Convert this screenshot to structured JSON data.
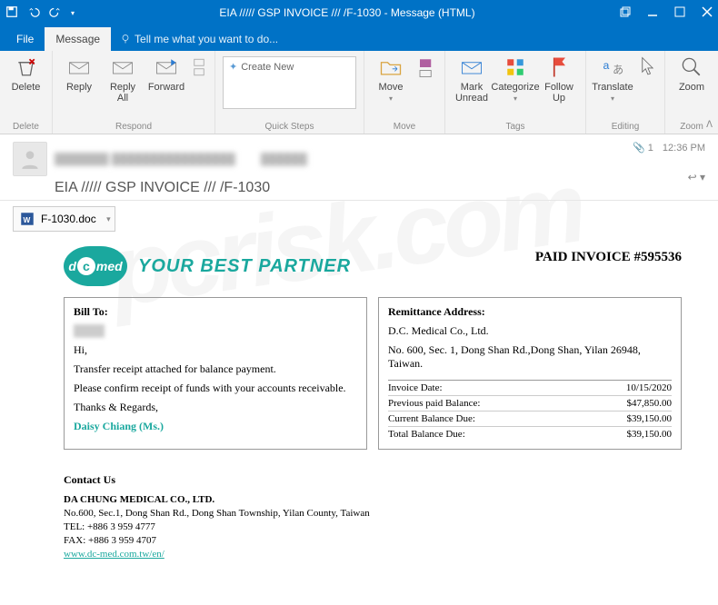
{
  "window": {
    "title": "EIA ///// GSP INVOICE /// /F-1030 - Message (HTML)"
  },
  "menu": {
    "file": "File",
    "message": "Message",
    "tell_me": "Tell me what you want to do..."
  },
  "ribbon": {
    "delete": {
      "label": "Delete",
      "group": "Delete"
    },
    "respond": {
      "reply": "Reply",
      "reply_all": "Reply\nAll",
      "forward": "Forward",
      "group": "Respond"
    },
    "quicksteps": {
      "create_new": "Create New",
      "group": "Quick Steps"
    },
    "move": {
      "move": "Move",
      "group": "Move"
    },
    "tags": {
      "mark_unread": "Mark\nUnread",
      "categorize": "Categorize",
      "follow_up": "Follow\nUp",
      "group": "Tags"
    },
    "editing": {
      "translate": "Translate",
      "group": "Editing"
    },
    "zoom": {
      "zoom": "Zoom",
      "group": "Zoom"
    }
  },
  "header": {
    "subject": "EIA ///// GSP INVOICE /// /F-1030",
    "attach_count": "1",
    "time": "12:36 PM"
  },
  "attachment": {
    "name": "F-1030.doc"
  },
  "email": {
    "tagline": "YOUR BEST PARTNER",
    "invoice_title": "PAID  INVOICE #595536",
    "bill_to": {
      "heading": "Bill To:",
      "greeting": "Hi,",
      "line1": "Transfer receipt attached for balance payment.",
      "line2": "Please confirm receipt of funds with your accounts receivable.",
      "thanks": "Thanks & Regards,",
      "signature": "Daisy Chiang (Ms.)"
    },
    "remit": {
      "heading": "Remittance Address:",
      "company": "D.C. Medical Co., Ltd.",
      "address": "No. 600, Sec. 1, Dong Shan Rd.,Dong Shan, Yilan 26948, Taiwan.",
      "rows": [
        {
          "label": "Invoice Date:",
          "value": "10/15/2020"
        },
        {
          "label": "Previous paid Balance:",
          "value": "$47,850.00"
        },
        {
          "label": "Current Balance Due:",
          "value": "$39,150.00"
        },
        {
          "label": "Total Balance Due:",
          "value": "$39,150.00"
        }
      ]
    },
    "contact": {
      "heading": "Contact Us",
      "company": "DA CHUNG MEDICAL CO., LTD.",
      "address": "No.600, Sec.1, Dong Shan Rd., Dong Shan Township, Yilan County, Taiwan",
      "tel": "TEL: +886 3 959 4777",
      "fax": "FAX: +886 3 959 4707",
      "url": "www.dc-med.com.tw/en/"
    }
  }
}
